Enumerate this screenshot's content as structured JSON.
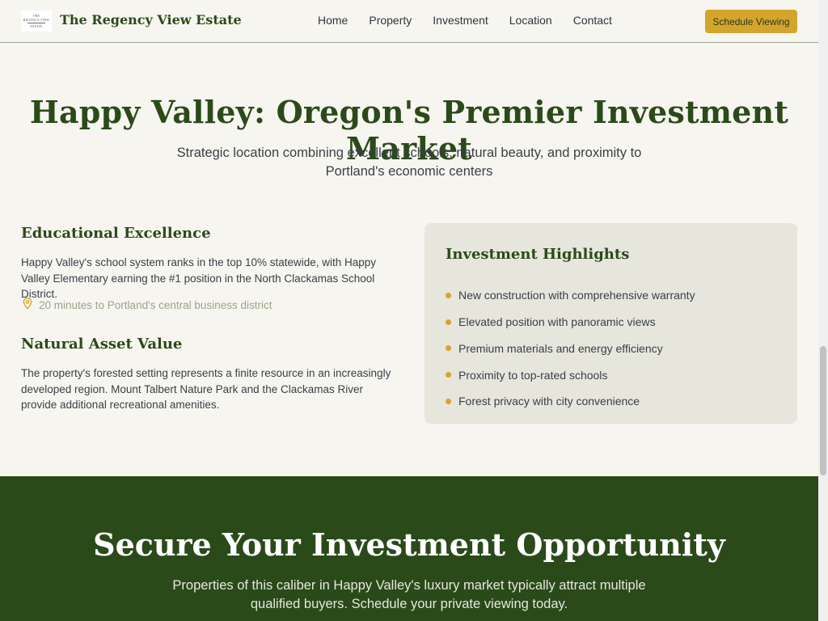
{
  "header": {
    "logo_text_line1": "THE",
    "logo_text_line2": "REGENCY VIEW",
    "logo_text_line3": "ESTATE",
    "brand_name": "The Regency View Estate",
    "nav": [
      "Home",
      "Property",
      "Investment",
      "Location",
      "Contact"
    ],
    "cta_label": "Schedule Viewing"
  },
  "hero": {
    "title": "Happy Valley: Oregon's Premier Investment Market",
    "subtitle": "Strategic location combining excellent schools, natural beauty, and proximity to Portland's economic centers"
  },
  "education": {
    "heading": "Educational Excellence",
    "body": "Happy Valley's school system ranks in the top 10% statewide, with Happy Valley Elementary earning the #1 position in the North Clackamas School District.",
    "location_note": "20 minutes to Portland's central business district",
    "location_icon": "map-pin-icon"
  },
  "nature": {
    "heading": "Natural Asset Value",
    "body": "The property's forested setting represents a finite resource in an increasingly developed region. Mount Talbert Nature Park and the Clackamas River provide additional recreational amenities."
  },
  "highlights": {
    "title": "Investment Highlights",
    "items": [
      "New construction with comprehensive warranty",
      "Elevated position with panoramic views",
      "Premium materials and energy efficiency",
      "Proximity to top-rated schools",
      "Forest privacy with city convenience"
    ]
  },
  "cta": {
    "title": "Secure Your Investment Opportunity",
    "subtitle": "Properties of this caliber in Happy Valley's luxury market typically attract multiple qualified buyers. Schedule your private viewing today."
  },
  "colors": {
    "brand_green": "#2b4a1a",
    "accent_gold": "#d4a52c",
    "background": "#f7f5f0",
    "card_bg": "#e6e6dc"
  }
}
